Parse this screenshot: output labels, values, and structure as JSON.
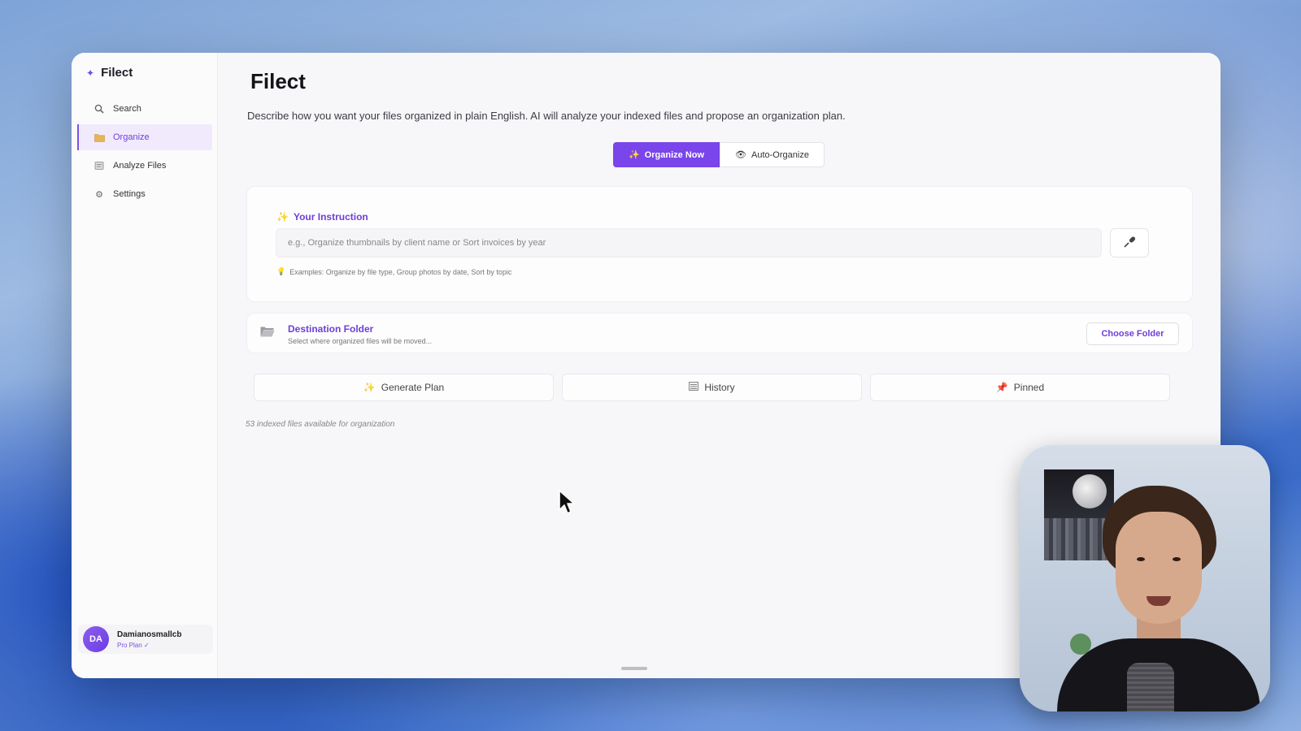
{
  "app": {
    "name": "Filect",
    "page_title": "Filect",
    "description": "Describe how you want your files organized in plain English. AI will analyze your indexed files and propose an organization plan."
  },
  "sidebar": {
    "items": [
      {
        "label": "Search",
        "icon": "search-icon"
      },
      {
        "label": "Organize",
        "icon": "folder-icon",
        "active": true
      },
      {
        "label": "Analyze Files",
        "icon": "document-icon"
      },
      {
        "label": "Settings",
        "icon": "gear-icon"
      }
    ],
    "user": {
      "initials": "DA",
      "name": "Damianosmallcb",
      "plan": "Pro Plan ✓"
    }
  },
  "mode_toggle": {
    "primary_label": "Organize Now",
    "secondary_label": "Auto-Organize"
  },
  "instruction": {
    "heading": "Your Instruction",
    "placeholder": "e.g., Organize thumbnails by client name or Sort invoices by year",
    "value": "",
    "examples": "Examples: Organize by file type, Group photos by date, Sort by topic"
  },
  "destination": {
    "title": "Destination Folder",
    "subtitle": "Select where organized files will be moved...",
    "choose_label": "Choose Folder"
  },
  "actions": {
    "generate_label": "Generate Plan",
    "history_label": "History",
    "pinned_label": "Pinned"
  },
  "status": {
    "indexed_text": "53 indexed files available for organization"
  },
  "colors": {
    "accent": "#7a45ea",
    "accent_text": "#6e3fd8",
    "active_bg": "#f1eafc"
  }
}
